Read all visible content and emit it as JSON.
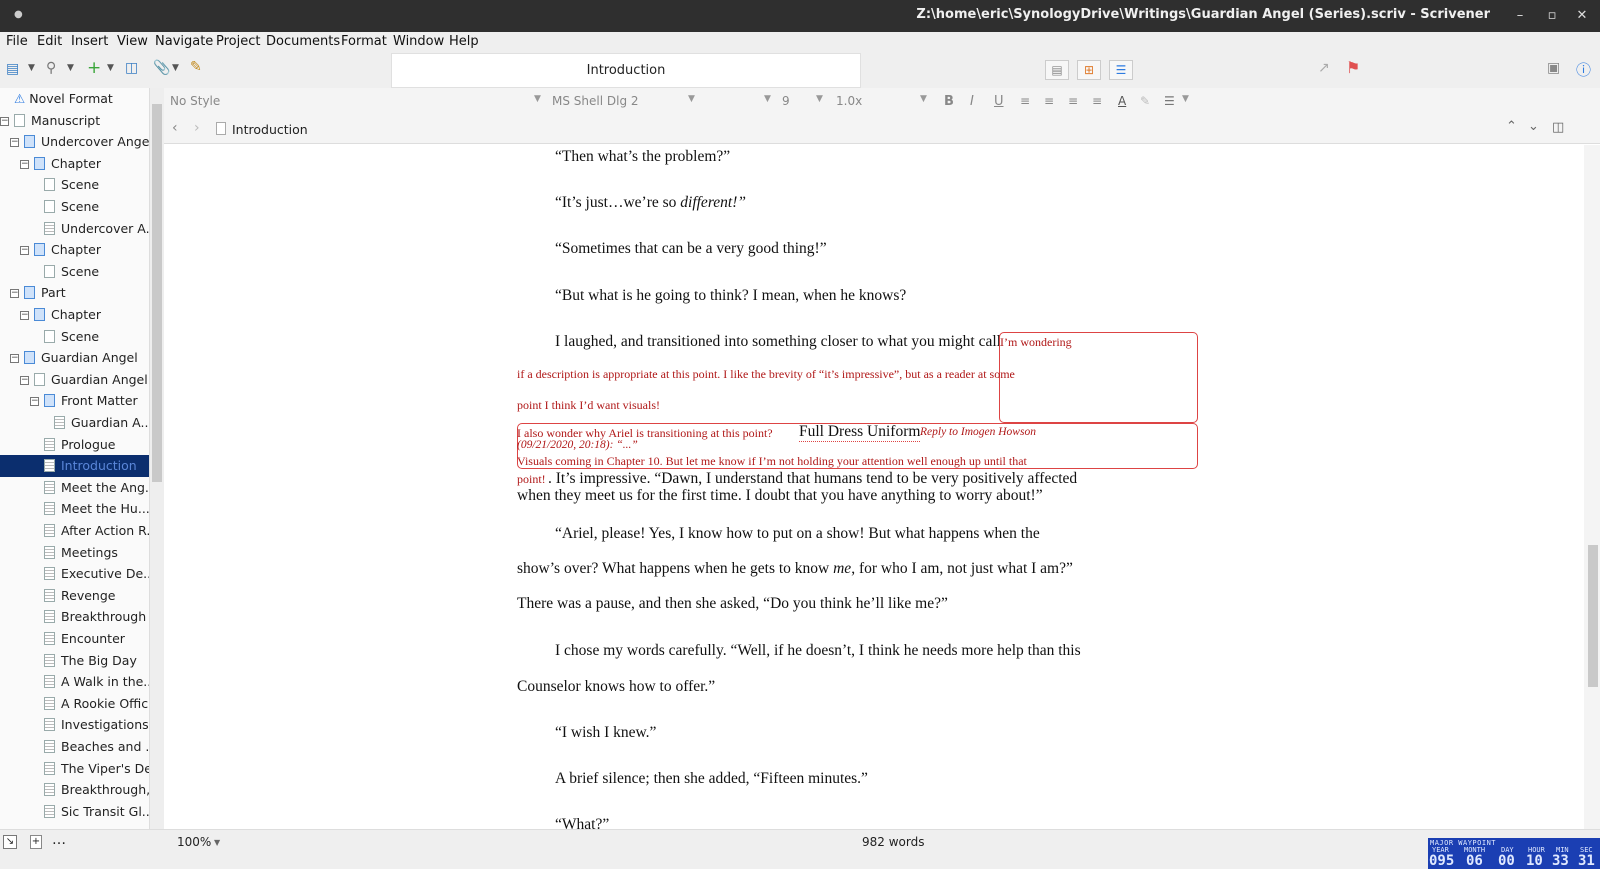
{
  "window": {
    "title": "Z:\\home\\eric\\SynologyDrive\\Writings\\Guardian Angel (Series).scriv - Scrivener",
    "min": "–",
    "max": "▫",
    "close": "✕"
  },
  "menu": [
    "File",
    "Edit",
    "Insert",
    "View",
    "Navigate",
    "Project",
    "Documents",
    "Format",
    "Window",
    "Help"
  ],
  "toolbar": {
    "doc_title": "Introduction"
  },
  "binder": [
    {
      "label": "Novel Format",
      "icon": "warning-icon"
    },
    {
      "label": "Manuscript"
    },
    {
      "label": "Undercover Angel"
    },
    {
      "label": "Chapter"
    },
    {
      "label": "Scene"
    },
    {
      "label": "Scene"
    },
    {
      "label": "Undercover A..."
    },
    {
      "label": "Chapter"
    },
    {
      "label": "Scene"
    },
    {
      "label": "Part"
    },
    {
      "label": "Chapter"
    },
    {
      "label": "Scene"
    },
    {
      "label": "Guardian Angel"
    },
    {
      "label": "Guardian Angel..."
    },
    {
      "label": "Front Matter"
    },
    {
      "label": "Guardian A..."
    },
    {
      "label": "Prologue"
    },
    {
      "label": "Introduction",
      "selected": true
    },
    {
      "label": "Meet the Ang..."
    },
    {
      "label": "Meet the Hu..."
    },
    {
      "label": "After Action R..."
    },
    {
      "label": "Meetings"
    },
    {
      "label": "Executive De..."
    },
    {
      "label": "Revenge"
    },
    {
      "label": "Breakthrough"
    },
    {
      "label": "Encounter"
    },
    {
      "label": "The Big Day"
    },
    {
      "label": "A Walk in the..."
    },
    {
      "label": "A Rookie Offic..."
    },
    {
      "label": "Investigations"
    },
    {
      "label": "Beaches and ..."
    },
    {
      "label": "The Viper's Den"
    },
    {
      "label": "Breakthrough,..."
    },
    {
      "label": "Sic Transit Gl..."
    }
  ],
  "formatbar": {
    "style": "No Style",
    "font": "MS Shell Dlg 2",
    "size": "9",
    "spacing": "1.0x"
  },
  "header": {
    "doc_name": "Introduction"
  },
  "editor": {
    "p1": "“Then what’s the problem?”",
    "p2a": "“It’s just…we’re so ",
    "p2b": "different!”",
    "p3": "“Sometimes that can be a very good thing!”",
    "p4": "“But what is he going to think? I mean, when he knows?",
    "p5": "I laughed, and transitioned into something closer to what you might call",
    "c1a": "I’m wondering",
    "c1b": "if a description is appropriate at this point. I like the brevity of “it’s impressive”, but as a reader at some",
    "c1c": "point I think I’d want visuals!",
    "c2a": "I also wonder why Ariel is transitioning at this point?",
    "inline": "Full Dress Uniform",
    "reply": "Reply to Imogen Howson",
    "reply_meta": "(09/21/2020, 20:18): “...”",
    "c3a": "Visuals coming in Chapter 10. But let me know if I’m not holding your attention well enough up until that",
    "c3b": "point!",
    "p6a": ". It’s impressive. “Dawn, I understand that humans tend to be very positively affected",
    "p6b": "when they meet us for the first time. I doubt that you have anything to worry about!”",
    "p7a": "“Ariel, please! Yes, I know how to put on a show! But what happens when the",
    "p7b": "show’s over? What happens when he gets to know ",
    "p7b_em": "me",
    "p7b_tail": ", for who I am, not just what I am?”",
    "p8": "There was a pause, and then she asked, “Do you think he’ll like me?”",
    "p9a": "I chose my words carefully. “Well, if he doesn’t, I think he needs more help than this",
    "p9b": "Counselor knows how to offer.”",
    "p10": "“I wish I knew.”",
    "p11": "A brief silence; then she added, “Fifteen minutes.”",
    "p12": "“What?”"
  },
  "footer": {
    "zoom": "100%",
    "words": "982 words",
    "more": "…"
  },
  "waypoint": {
    "label": "MAJOR WAYPOINT",
    "cols": [
      "YEAR",
      "MONTH",
      "DAY",
      "HOUR",
      "MIN",
      "SEC"
    ],
    "values": [
      "095",
      "06",
      "00",
      "10",
      "33",
      "31"
    ]
  },
  "colors": {
    "accent": "#3c7fc4",
    "selection": "#0b2e6e",
    "comment": "#b01818"
  }
}
